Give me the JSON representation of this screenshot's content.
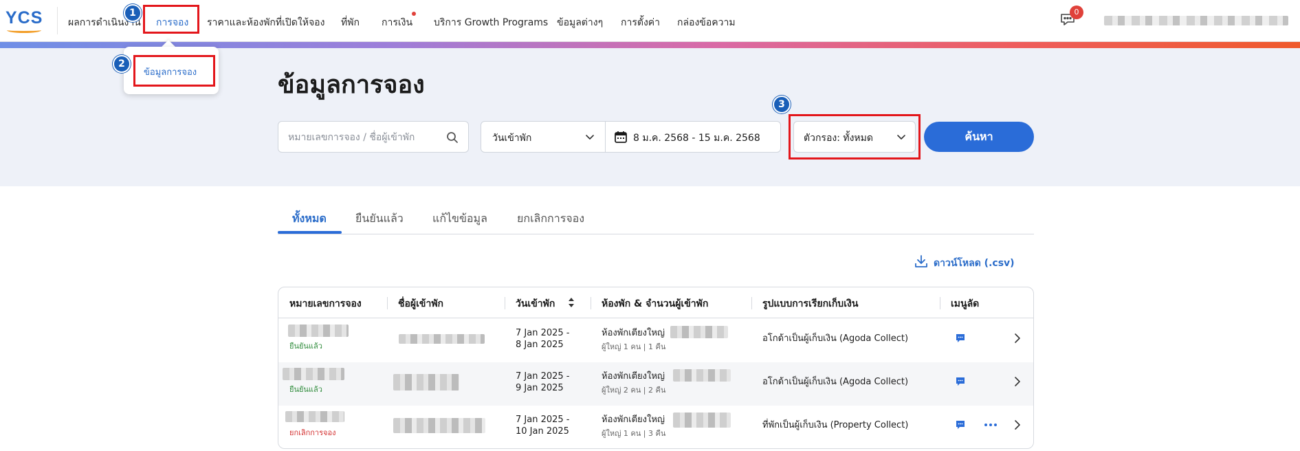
{
  "app": {
    "logo_text": "YCS"
  },
  "nav": {
    "items": [
      {
        "label": "ผลการดำเนินงาน"
      },
      {
        "label": "การจอง"
      },
      {
        "label": "ราคาและห้องพักที่เปิดให้จอง"
      },
      {
        "label": "ที่พัก"
      },
      {
        "label": "การเงิน"
      },
      {
        "label": "บริการ Growth Programs"
      },
      {
        "label": "ข้อมูลต่างๆ"
      },
      {
        "label": "การตั้งค่า"
      },
      {
        "label": "กล่องข้อความ"
      }
    ],
    "active_index": 1,
    "notification_badge": "0"
  },
  "dropdown": {
    "item": "ข้อมูลการจอง"
  },
  "annotations": {
    "step1": "1",
    "step2": "2",
    "step3": "3"
  },
  "page": {
    "title": "ข้อมูลการจอง"
  },
  "search": {
    "placeholder": "หมายเลขการจอง / ชื่อผู้เข้าพัก",
    "value": ""
  },
  "date_filter": {
    "type": "วันเข้าพัก",
    "range": "8 ม.ค. 2568 - 15 ม.ค. 2568"
  },
  "filter": {
    "label": "ตัวกรอง: ทั้งหมด"
  },
  "search_button": {
    "label": "ค้นหา"
  },
  "tabs": [
    {
      "label": "ทั้งหมด",
      "active": true
    },
    {
      "label": "ยืนยันแล้ว",
      "active": false
    },
    {
      "label": "แก้ไขข้อมูล",
      "active": false
    },
    {
      "label": "ยกเลิกการจอง",
      "active": false
    }
  ],
  "download": {
    "label": "ดาวน์โหลด (.csv)"
  },
  "table": {
    "headers": [
      "หมายเลขการจอง",
      "ชื่อผู้เข้าพัก",
      "วันเข้าพัก",
      "ห้องพัก & จำนวนผู้เข้าพัก",
      "รูปแบบการเรียกเก็บเงิน",
      "เมนูลัด"
    ],
    "rows": [
      {
        "status": "ยืนยันแล้ว",
        "status_color": "#2e8b3a",
        "checkin": "7 Jan 2025 -",
        "checkout": "8 Jan 2025",
        "room": "ห้องพักเตียงใหญ่",
        "guests": "ผู้ใหญ่ 1 คน | 1 คืน",
        "payment": "อโกด้าเป็นผู้เก็บเงิน (Agoda Collect)"
      },
      {
        "status": "ยืนยันแล้ว",
        "status_color": "#2e8b3a",
        "checkin": "7 Jan 2025 -",
        "checkout": "9 Jan 2025",
        "room": "ห้องพักเตียงใหญ่",
        "guests": "ผู้ใหญ่ 2 คน | 2 คืน",
        "payment": "อโกด้าเป็นผู้เก็บเงิน (Agoda Collect)"
      },
      {
        "status": "ยกเลิกการจอง",
        "status_color": "#d32f2f",
        "checkin": "7 Jan 2025 -",
        "checkout": "10 Jan 2025",
        "room": "ห้องพักเตียงใหญ่",
        "guests": "ผู้ใหญ่ 1 คน | 3 คืน",
        "payment": "ที่พักเป็นผู้เก็บเงิน (Property Collect)"
      }
    ]
  },
  "icons": {
    "search": "search-icon",
    "calendar": "calendar-icon",
    "chevron": "chevron-down-icon",
    "download": "download-icon",
    "message": "message-icon",
    "more": "more-icon",
    "row_chevron": "chevron-right-icon",
    "sort": "sort-icon",
    "chat": "chat-icon"
  },
  "colors": {
    "accent": "#2a6cd8",
    "highlight": "#e3161b",
    "step_badge": "#1a5fb8",
    "confirmed": "#2e8b3a",
    "cancelled": "#d32f2f"
  }
}
